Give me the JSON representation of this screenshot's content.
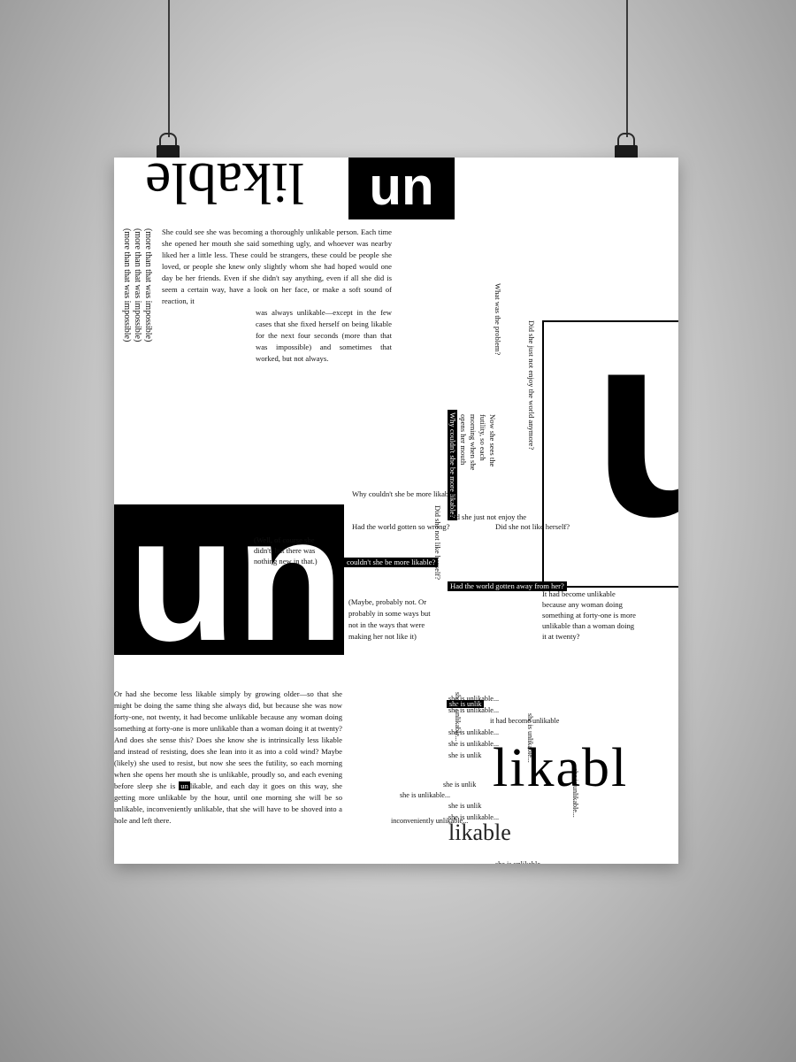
{
  "title": {
    "un_top": "un",
    "likable_top": "likable"
  },
  "rotated_lines": [
    "(more than that was impossible)",
    "(more than that was impossible)",
    "(more than that was impossible)"
  ],
  "para1_top": "She could see she was becoming a thoroughly unlikable person. Each time she opened her mouth she said something ugly, and whoever was nearby liked her a little less. These could be strangers, these could be people she loved, or people she knew only slightly whom she had hoped would one day be her friends. Even if she didn't say anything, even if all she did is seem a certain way, have a look on her face, or make a soft sound of reaction, it",
  "para1_bottom": "was always unlikable—except in the few cases that she fixed herself on being likable for the next four seconds (more than that was impossible) and sometimes that worked, but not always.",
  "middle": {
    "q_problem": "What was the problem?",
    "q_enjoy": "Did she just not enjoy the world anymore?",
    "futility": "Now she sees the futility, so each morning when she opens her mouth",
    "black_vertical": "Why couldn't she be more likable?",
    "q_likable": "Why couldn't she be more likable?",
    "q_gotten": "Had the world gotten so wrong?",
    "q_enjoy2": "Did she just not enjoy the",
    "q_like_herself": "Did she not like herself?",
    "q_not_like_v": "Did she not like herself?",
    "black_likable": "couldn't she be more likable?",
    "black_away": "Had the world gotten away from her?",
    "well": "(Well, of course she didn't, but there was nothing new in that.)",
    "maybe": "(Maybe, probably not. Or probably in some ways but not in the ways that were making her not like it)",
    "forty": "It had become unlikable because any woman doing something at forty-one is more unlikable than a woman doing it at twenty?",
    "big_un": "un",
    "big_u": "u"
  },
  "lower": {
    "para": "Or had she become less likable simply by growing older—so that she might be doing the same thing she always did, but because she was now forty-one, not twenty, it had become unlikable because any woman doing something at forty-one is more unlikable than a woman doing it at twenty? And does she sense this? Does she know she is intrinsically less likable and instead of resisting, does she lean into it as into a cold wind? Maybe (likely) she used to resist, but now she sees the futility, so each morning when she opens her mouth she is unlikable, proudly so, and each evening before sleep she is",
    "un_badge": "un",
    "para_end": "likable, and each day it goes on this way, she getting more unlikable by the hour, until one morning she will be so unlikable, inconveniently unlikable, that she will have to be shoved into a hole and left there.",
    "likabl": "likabl",
    "likable_small": "likable",
    "it_had": "it had become unlikable",
    "she_is": "she is unlikable...",
    "she_is_short": "she is unlik",
    "inconveniently": "inconveniently unlikable..."
  },
  "colors": {
    "ink": "#000000",
    "paper": "#ffffff",
    "wall": "#cfcfcf"
  }
}
